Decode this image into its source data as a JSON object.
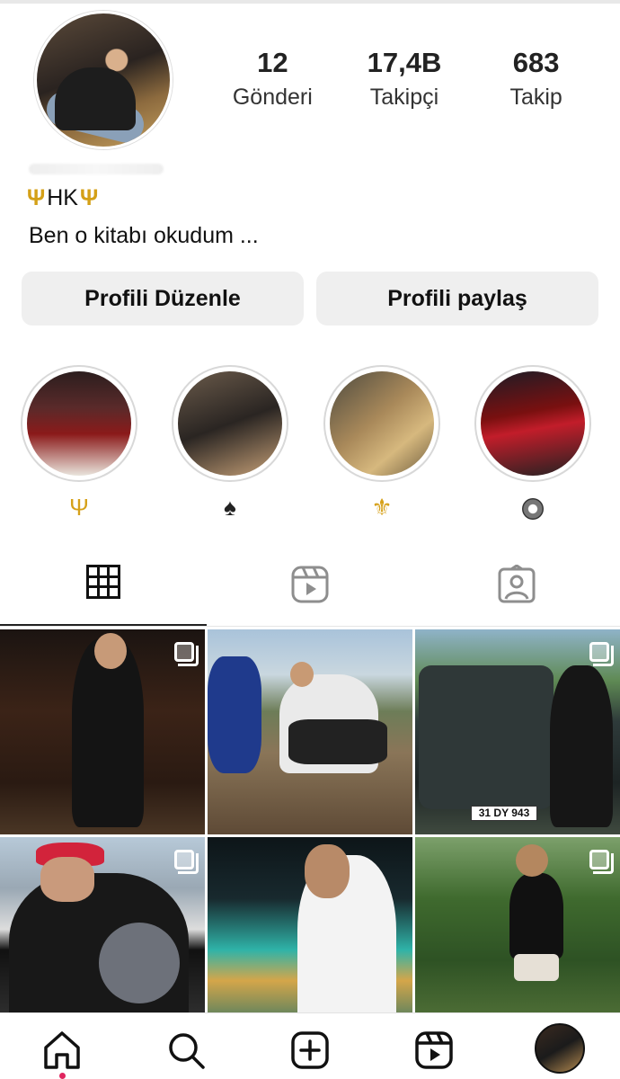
{
  "profile": {
    "stats": [
      {
        "value": "12",
        "label": "Gönderi"
      },
      {
        "value": "17,4B",
        "label": "Takipçi"
      },
      {
        "value": "683",
        "label": "Takip"
      }
    ],
    "name": "HK",
    "bio": "Ben o kitabı okudum ..."
  },
  "buttons": {
    "edit": "Profili Düzenle",
    "share": "Profili paylaş"
  },
  "highlights": [
    {
      "icon": "trident"
    },
    {
      "icon": "spade"
    },
    {
      "icon": "fleur-de-lis"
    },
    {
      "icon": "circle-dot"
    }
  ],
  "posts": {
    "plate_text": "31 DY 943"
  },
  "colors": {
    "accent_gold": "#d6a11a",
    "button_bg": "#efefef",
    "notification": "#e0245e"
  }
}
